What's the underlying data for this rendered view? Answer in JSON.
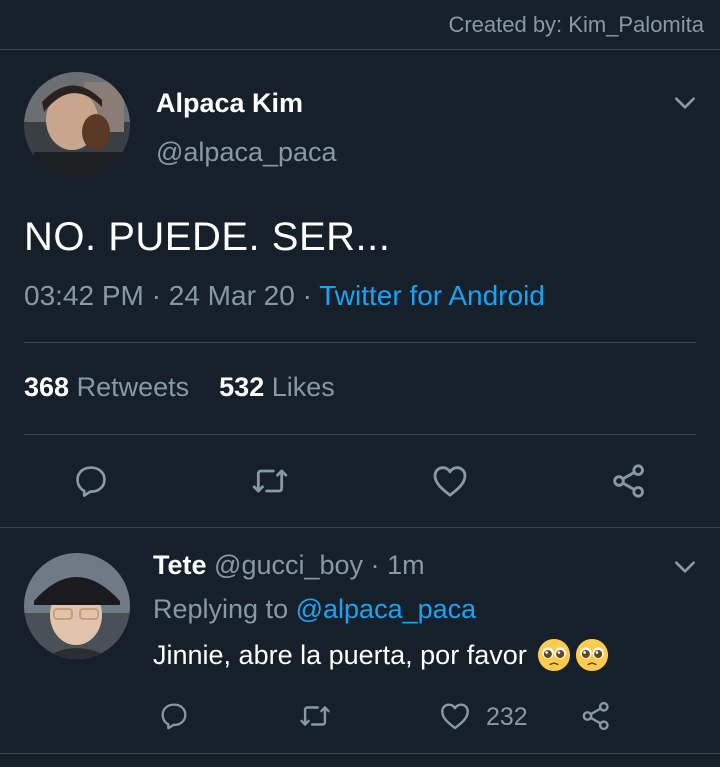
{
  "watermark": "Created by: Kim_Palomita",
  "colors": {
    "background": "#15202b",
    "divider": "#38444d",
    "muted": "#8899a6",
    "accent": "#1da1f2"
  },
  "main_tweet": {
    "display_name": "Alpaca Kim",
    "handle": "@alpaca_paca",
    "text": "NO. PUEDE. SER...",
    "time": "03:42 PM",
    "date": "24 Mar 20",
    "source": "Twitter for Android",
    "retweets_count": "368",
    "retweets_label": "Retweets",
    "likes_count": "532",
    "likes_label": "Likes",
    "actions": [
      "reply-icon",
      "retweet-icon",
      "heart-icon",
      "share-icon"
    ]
  },
  "reply_tweet": {
    "display_name": "Tete",
    "handle": "@gucci_boy",
    "age": "1m",
    "replying_prefix": "Replying to",
    "replying_to": "@alpaca_paca",
    "text": "Jinnie, abre la puerta, por favor",
    "emojis": [
      "pleading-face-emoji",
      "pleading-face-emoji"
    ],
    "like_count": "232"
  }
}
